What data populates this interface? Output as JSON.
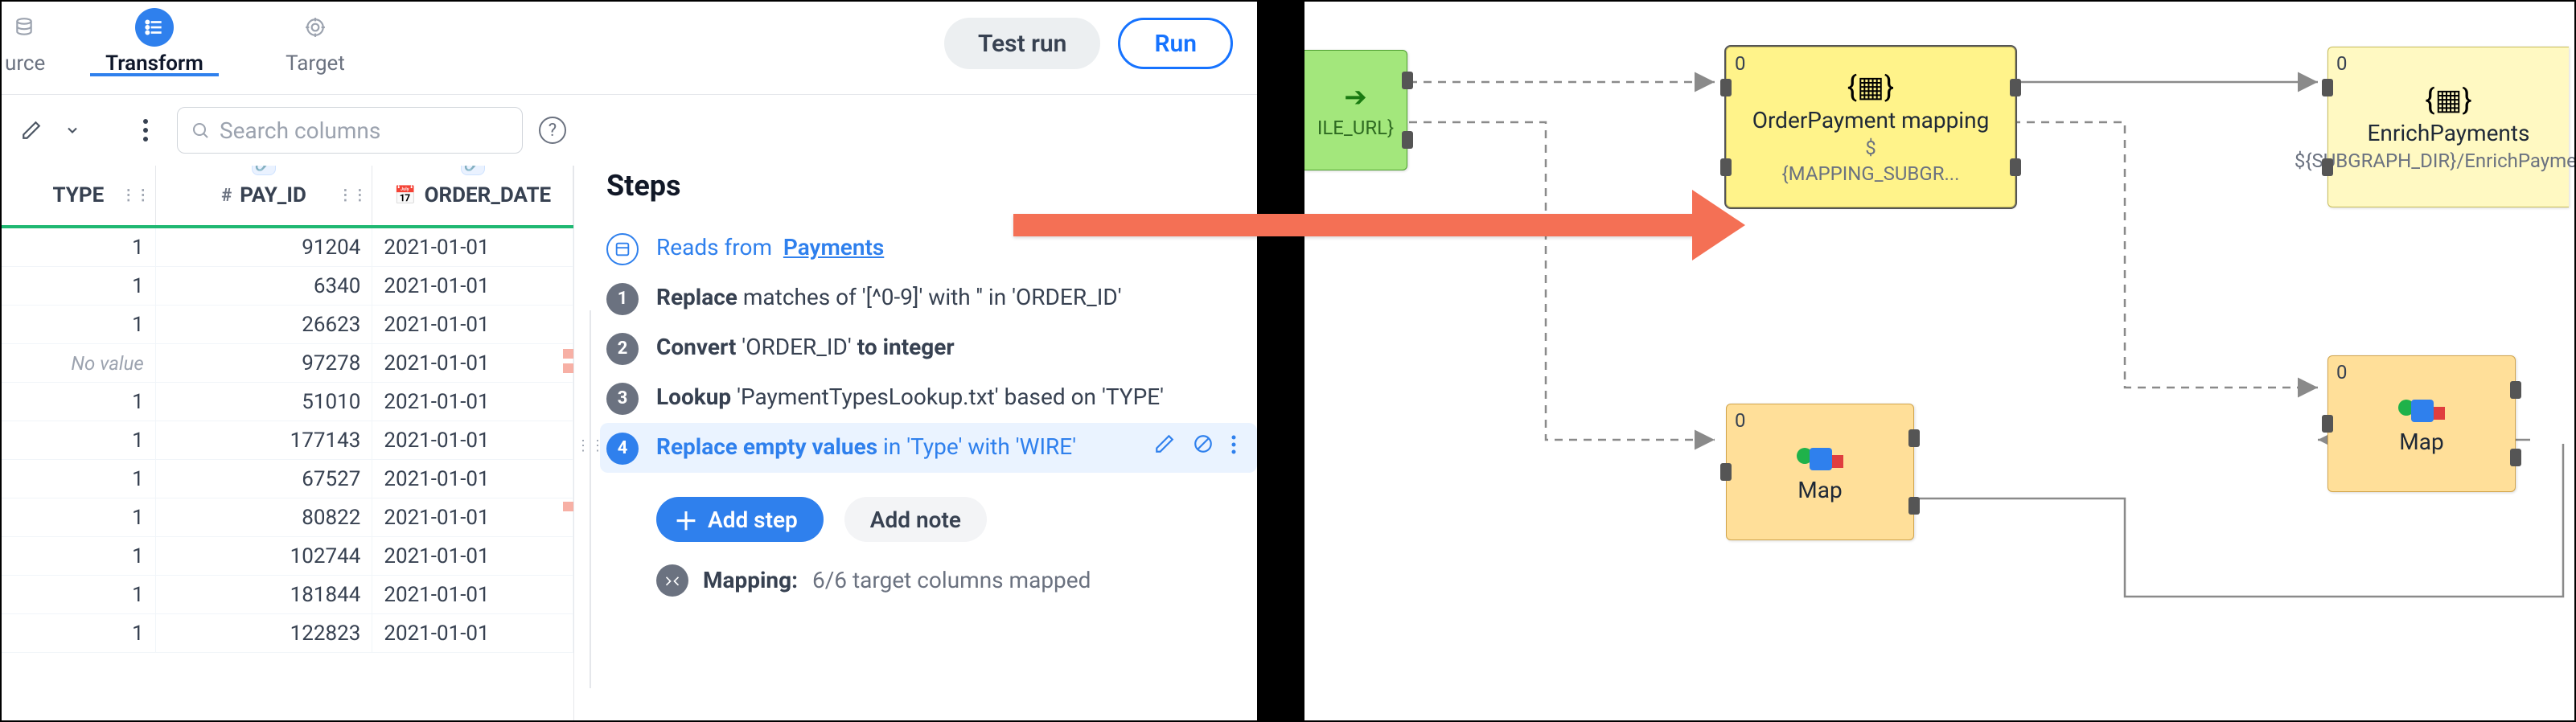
{
  "tabs": {
    "source": "urce",
    "transform": "Transform",
    "target": "Target"
  },
  "buttons": {
    "test_run": "Test run",
    "run": "Run",
    "add_step": "Add step",
    "add_note": "Add note"
  },
  "search": {
    "placeholder": "Search columns"
  },
  "columns": {
    "type": "TYPE",
    "pay_id": "PAY_ID",
    "order_date": "ORDER_DATE"
  },
  "rows": [
    {
      "type": "1",
      "pay": "91204",
      "date": "2021-01-01"
    },
    {
      "type": "1",
      "pay": "6340",
      "date": "2021-01-01"
    },
    {
      "type": "1",
      "pay": "26623",
      "date": "2021-01-01"
    },
    {
      "type": "No value",
      "pay": "97278",
      "date": "2021-01-01",
      "novalue": true
    },
    {
      "type": "1",
      "pay": "51010",
      "date": "2021-01-01"
    },
    {
      "type": "1",
      "pay": "177143",
      "date": "2021-01-01"
    },
    {
      "type": "1",
      "pay": "67527",
      "date": "2021-01-01"
    },
    {
      "type": "1",
      "pay": "80822",
      "date": "2021-01-01"
    },
    {
      "type": "1",
      "pay": "102744",
      "date": "2021-01-01"
    },
    {
      "type": "1",
      "pay": "181844",
      "date": "2021-01-01"
    },
    {
      "type": "1",
      "pay": "122823",
      "date": "2021-01-01"
    }
  ],
  "steps": {
    "title": "Steps",
    "reads_from_label": "Reads from",
    "reads_from_link": "Payments",
    "items": [
      {
        "n": "1",
        "prefix": "Replace",
        "body": " matches of '[^0-9]' with '' in 'ORDER_ID'"
      },
      {
        "n": "2",
        "prefix": "Convert",
        "body": " 'ORDER_ID' ",
        "suffix": "to integer"
      },
      {
        "n": "3",
        "prefix": "Lookup",
        "body": " 'PaymentTypesLookup.txt' based on 'TYPE'"
      },
      {
        "n": "4",
        "prefix": "Replace empty values",
        "body": " in 'Type' with 'WIRE'"
      }
    ],
    "mapping_label": "Mapping:",
    "mapping_value": "6/6 target columns mapped"
  },
  "diagram": {
    "green": {
      "label": "ILE_URL}"
    },
    "orderpayment": {
      "title": "OrderPayment mapping",
      "sub1": "$",
      "sub2": "{MAPPING_SUBGR..."
    },
    "enrich": {
      "title": "EnrichPayments",
      "sub": "${SUBGRAPH_DIR}/EnrichPaymen..."
    },
    "map_label": "Map",
    "zero": "0"
  }
}
